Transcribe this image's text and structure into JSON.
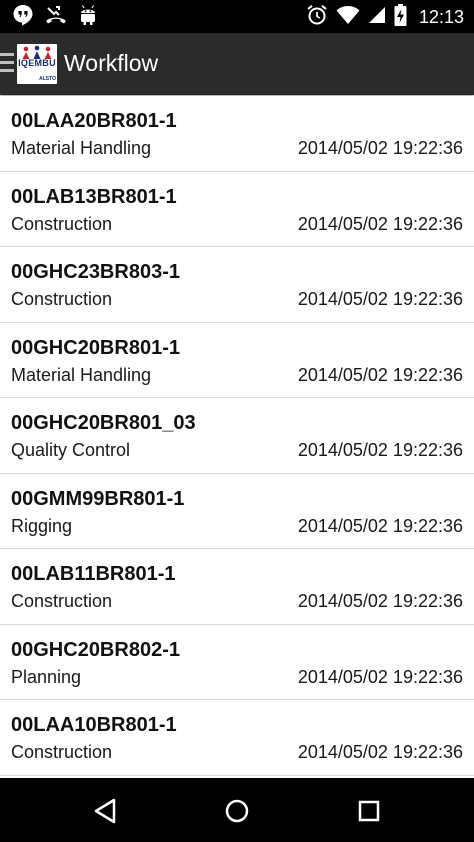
{
  "status_bar": {
    "time": "12:13",
    "left_icons": [
      "hangouts-icon",
      "missed-call-icon",
      "android-icon"
    ],
    "right_icons": [
      "alarm-icon",
      "wifi-icon",
      "signal-icon",
      "battery-charging-icon"
    ]
  },
  "action_bar": {
    "title": "Workflow",
    "logo_text": "IQEMBU",
    "logo_subtext": "ALSTO"
  },
  "workflows": [
    {
      "id": "00LAA20BR801-1",
      "category": "Material Handling",
      "date": "2014/05/02 19:22:36"
    },
    {
      "id": "00LAB13BR801-1",
      "category": "Construction",
      "date": "2014/05/02 19:22:36"
    },
    {
      "id": "00GHC23BR803-1",
      "category": "Construction",
      "date": "2014/05/02 19:22:36"
    },
    {
      "id": "00GHC20BR801-1",
      "category": "Material Handling",
      "date": "2014/05/02 19:22:36"
    },
    {
      "id": "00GHC20BR801_03",
      "category": "Quality Control",
      "date": "2014/05/02 19:22:36"
    },
    {
      "id": "00GMM99BR801-1",
      "category": "Rigging",
      "date": "2014/05/02 19:22:36"
    },
    {
      "id": "00LAB11BR801-1",
      "category": "Construction",
      "date": "2014/05/02 19:22:36"
    },
    {
      "id": "00GHC20BR802-1",
      "category": "Planning",
      "date": "2014/05/02 19:22:36"
    },
    {
      "id": "00LAA10BR801-1",
      "category": "Construction",
      "date": "2014/05/02 19:22:36"
    }
  ],
  "nav_bar": {
    "buttons": [
      "back-icon",
      "home-icon",
      "recents-icon"
    ]
  },
  "colors": {
    "status_bar": "#000000",
    "action_bar": "#2b2b2b",
    "list_background": "#ffffff",
    "divider": "#d9d9d9"
  }
}
